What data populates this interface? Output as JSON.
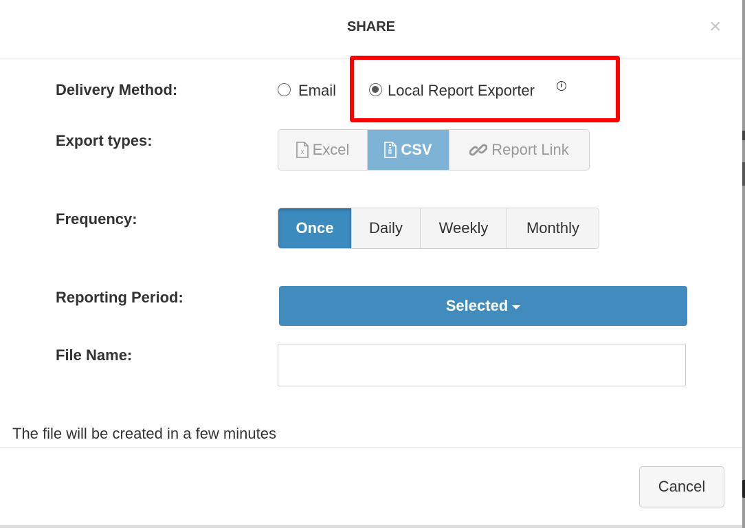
{
  "modal": {
    "title": "SHARE",
    "close_symbol": "×"
  },
  "delivery": {
    "label": "Delivery Method:",
    "options": [
      {
        "label": "Email",
        "checked": false
      },
      {
        "label": "Local Report Exporter",
        "checked": true
      }
    ],
    "info_icon": "info-icon",
    "info_glyph": "i"
  },
  "export_types": {
    "label": "Export types:",
    "options": [
      {
        "label": "Excel",
        "icon": "excel-file-icon",
        "active": false
      },
      {
        "label": "CSV",
        "icon": "zip-file-icon",
        "active": true
      },
      {
        "label": "Report Link",
        "icon": "link-icon",
        "active": false
      }
    ]
  },
  "frequency": {
    "label": "Frequency:",
    "options": [
      {
        "label": "Once",
        "active": true
      },
      {
        "label": "Daily",
        "active": false
      },
      {
        "label": "Weekly",
        "active": false
      },
      {
        "label": "Monthly",
        "active": false
      }
    ]
  },
  "reporting_period": {
    "label": "Reporting Period:",
    "button_label": "Selected"
  },
  "file_name": {
    "label": "File Name:",
    "value": "",
    "placeholder": ""
  },
  "info_message": "The file will be created in a few minutes",
  "footer": {
    "cancel_label": "Cancel"
  },
  "colors": {
    "highlight": "#ff0000",
    "primary": "#428bbd",
    "active_light": "#7fb3d5"
  }
}
